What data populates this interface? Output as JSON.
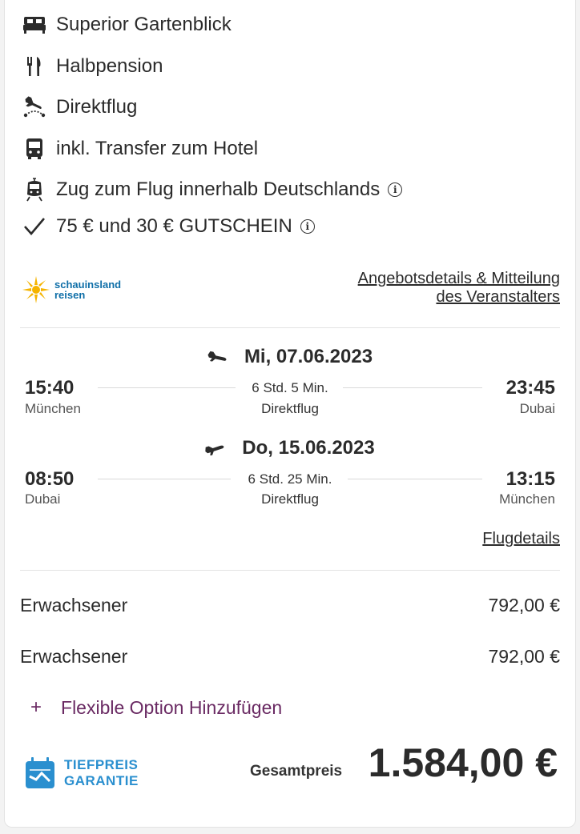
{
  "features": [
    {
      "icon": "bed-icon",
      "label": "Superior Gartenblick"
    },
    {
      "icon": "cutlery-icon",
      "label": "Halbpension"
    },
    {
      "icon": "direct-flight-icon",
      "label": "Direktflug"
    },
    {
      "icon": "bus-icon",
      "label": "inkl. Transfer zum Hotel"
    },
    {
      "icon": "train-icon",
      "label": "Zug zum Flug innerhalb Deutschlands"
    },
    {
      "icon": "checkmark-icon",
      "label": "75 € und 30 € GUTSCHEIN"
    }
  ],
  "operator": {
    "logo_line1": "schauinsland",
    "logo_line2": "reisen",
    "link_line1": "Angebotsdetails & Mitteilung",
    "link_line2": "des Veranstalters"
  },
  "outbound": {
    "date": "Mi, 07.06.2023",
    "dep_time": "15:40",
    "dep_city": "München",
    "duration": "6 Std. 5 Min.",
    "type": "Direktflug",
    "arr_time": "23:45",
    "arr_city": "Dubai"
  },
  "return": {
    "date": "Do, 15.06.2023",
    "dep_time": "08:50",
    "dep_city": "Dubai",
    "duration": "6 Std. 25 Min.",
    "type": "Direktflug",
    "arr_time": "13:15",
    "arr_city": "München"
  },
  "flight_details_link": "Flugdetails",
  "travellers": [
    {
      "label": "Erwachsener",
      "price": "792,00 €"
    },
    {
      "label": "Erwachsener",
      "price": "792,00 €"
    }
  ],
  "flexible_option": {
    "plus": "+",
    "label": "Flexible Option Hinzufügen"
  },
  "badge": {
    "line1": "TIEFPREIS",
    "line2": "GARANTIE"
  },
  "total": {
    "label": "Gesamtpreis",
    "value": "1.584,00 €"
  },
  "colors": {
    "accent_purple": "#6a2a63",
    "badge_blue": "#2a8fcf",
    "logo_blue": "#0f6fa8",
    "logo_sun": "#f5b400"
  }
}
